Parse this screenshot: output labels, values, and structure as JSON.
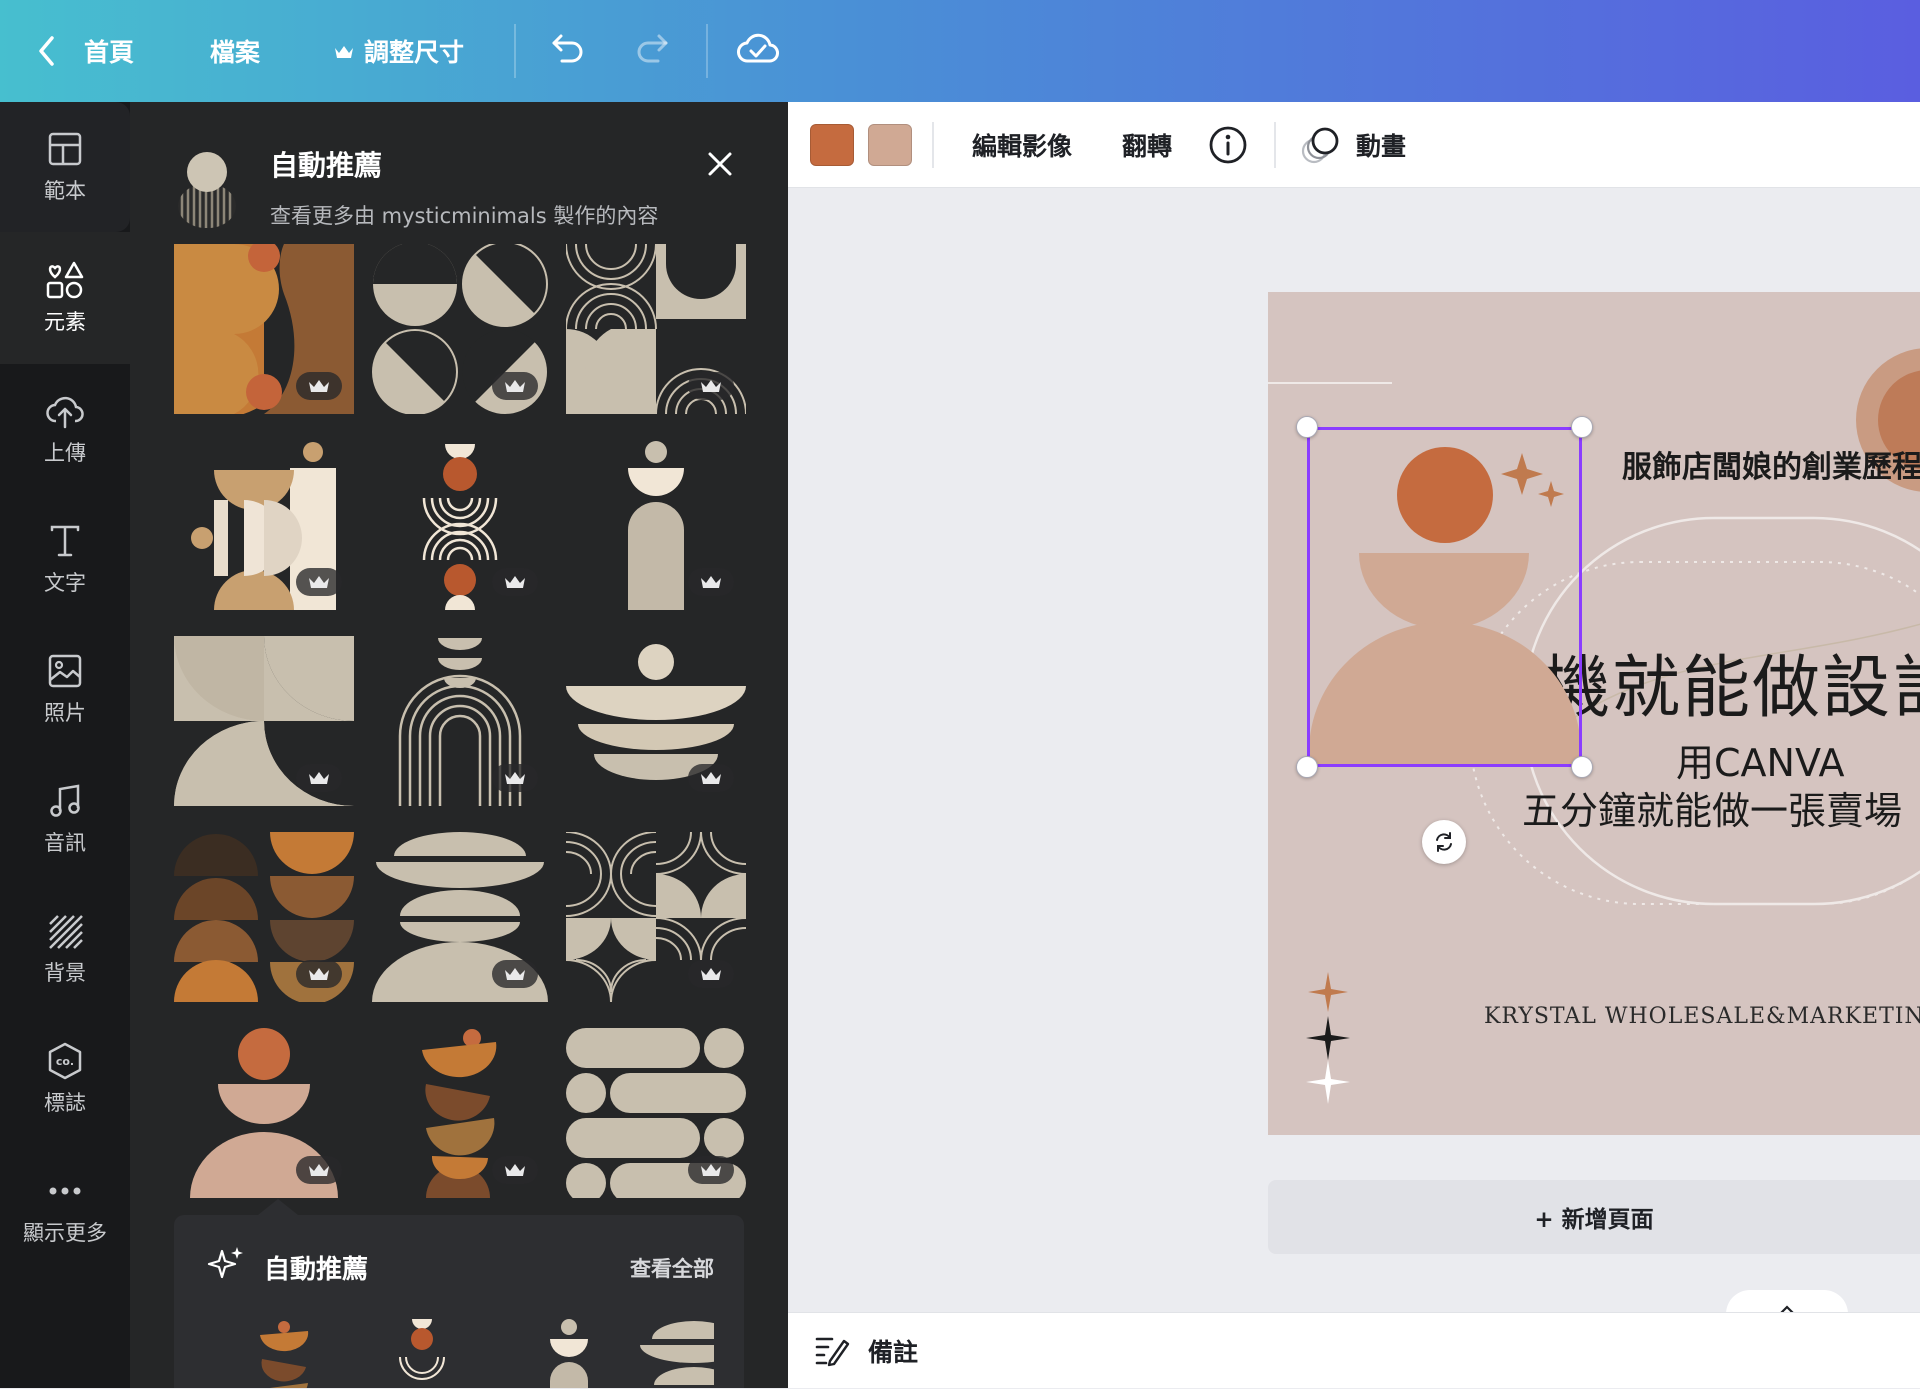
{
  "topbar": {
    "home_label": "首頁",
    "file_label": "檔案",
    "resize_label": "調整尺寸"
  },
  "rail": {
    "items": [
      {
        "label": "範本"
      },
      {
        "label": "元素"
      },
      {
        "label": "上傳"
      },
      {
        "label": "文字"
      },
      {
        "label": "照片"
      },
      {
        "label": "音訊"
      },
      {
        "label": "背景"
      },
      {
        "label": "標誌"
      },
      {
        "label": "顯示更多"
      }
    ]
  },
  "panel": {
    "title": "自動推薦",
    "subtitle": "查看更多由 mysticminimals 製作的內容",
    "recommend": {
      "title": "自動推薦",
      "see_all": "查看全部"
    }
  },
  "toolbar": {
    "swatches": [
      "#c56b3f",
      "#d0a994"
    ],
    "edit_image": "編輯影像",
    "flip": "翻轉",
    "animate": "動畫"
  },
  "design": {
    "small_title": "服飾店闆娘的創業歷程",
    "big_title": "手機就能做設計",
    "sub1": "用CANVA",
    "sub2": "五分鐘就能做一張賣場",
    "footer": "KRYSTAL WHOLESALE&MARKETING"
  },
  "canvas": {
    "add_page": "+ 新增頁面"
  },
  "notes": {
    "label": "備註"
  },
  "colors": {
    "accent_selection": "#8b3dff",
    "terracotta": "#c56b3f",
    "beige": "#d0a994",
    "stone": "#c8bfae"
  }
}
